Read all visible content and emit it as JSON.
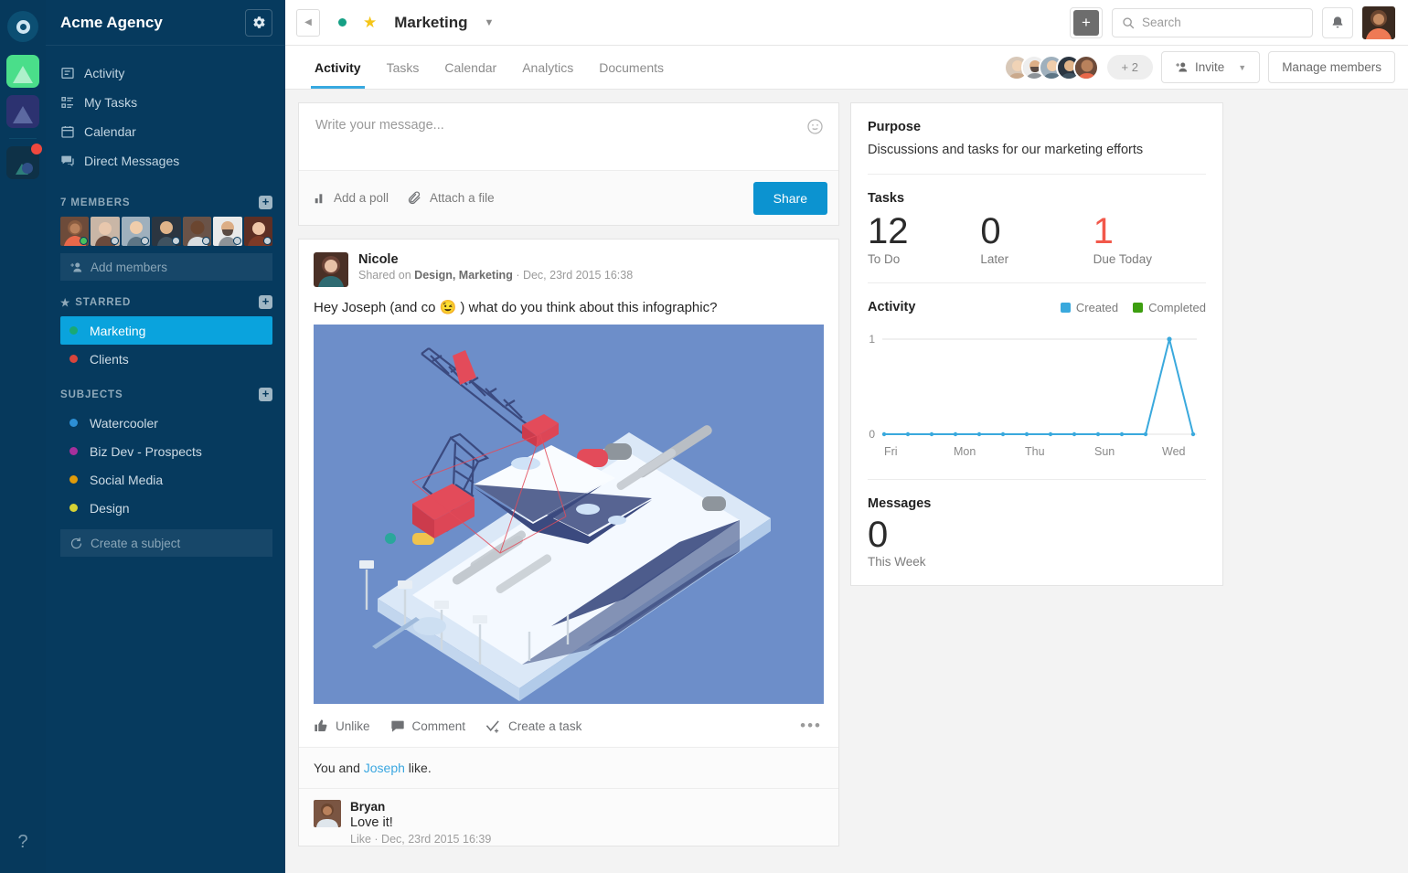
{
  "workspace": {
    "title": "Acme Agency",
    "gear_icon": "gear-icon",
    "rail_items": [
      "workspace-green",
      "workspace-navy",
      "workspace-dark"
    ],
    "help_label": "?"
  },
  "sidebar": {
    "nav": [
      {
        "label": "Activity",
        "icon": "activity-icon"
      },
      {
        "label": "My Tasks",
        "icon": "tasks-icon"
      },
      {
        "label": "Calendar",
        "icon": "calendar-icon"
      },
      {
        "label": "Direct Messages",
        "icon": "messages-icon"
      }
    ],
    "members_header": "7 MEMBERS",
    "members_count": 7,
    "member_status": [
      "online",
      "offline",
      "offline",
      "offline",
      "offline",
      "offline",
      "offline"
    ],
    "add_members_label": "Add members",
    "starred_header": "STARRED",
    "starred": [
      {
        "label": "Marketing",
        "color": "#19a974",
        "active": true
      },
      {
        "label": "Clients",
        "color": "#d9453c",
        "active": false
      }
    ],
    "subjects_header": "SUBJECTS",
    "subjects": [
      {
        "label": "Watercooler",
        "color": "#2d8fd5"
      },
      {
        "label": "Biz Dev - Prospects",
        "color": "#a6309c"
      },
      {
        "label": "Social Media",
        "color": "#e09b0a"
      },
      {
        "label": "Design",
        "color": "#d6d234"
      }
    ],
    "create_subject_label": "Create a subject"
  },
  "topbar": {
    "back_icon": "back-arrow-icon",
    "status_dot_color": "#16a085",
    "star_icon": "star-icon",
    "channel_name": "Marketing",
    "chevron_icon": "chevron-down-icon",
    "add_icon": "plus-icon",
    "search_placeholder": "Search",
    "search_value": "",
    "search_icon": "search-icon",
    "bell_icon": "bell-icon",
    "avatar": "user-avatar"
  },
  "tabs": [
    {
      "label": "Activity",
      "active": true
    },
    {
      "label": "Tasks",
      "active": false
    },
    {
      "label": "Calendar",
      "active": false
    },
    {
      "label": "Analytics",
      "active": false
    },
    {
      "label": "Documents",
      "active": false
    }
  ],
  "members_bar": {
    "overflow_label": "+ 2",
    "invite_label": "Invite",
    "invite_icon": "add-person-icon",
    "invite_chevron": "chevron-down-icon",
    "manage_label": "Manage members"
  },
  "composer": {
    "placeholder": "Write your message...",
    "value": "",
    "emoji_icon": "smiley-icon",
    "poll_label": "Add a poll",
    "poll_icon": "bar-chart-icon",
    "attach_label": "Attach a file",
    "attach_icon": "paperclip-icon",
    "share_label": "Share",
    "share_color": "#0c93d0"
  },
  "post": {
    "author": "Nicole",
    "meta_prefix": "Shared on ",
    "meta_channels": "Design, Marketing",
    "meta_suffix": " · Dec, 23rd 2015 16:38",
    "text": "Hey Joseph (and co 😉 ) what do you think about this infographic?",
    "image_alt": "isometric-crane-smartphone-illustration",
    "image_bg": "#6d8ec9",
    "actions": [
      {
        "label": "Unlike",
        "icon": "thumbs-up-icon"
      },
      {
        "label": "Comment",
        "icon": "comment-icon"
      },
      {
        "label": "Create a task",
        "icon": "check-task-icon"
      }
    ],
    "more_icon": "ellipsis-icon",
    "likes_prefix": "You  and  ",
    "likes_link": "Joseph",
    "likes_suffix": "  like.",
    "comment": {
      "author": "Bryan",
      "body": "Love it!",
      "meta": "Like · Dec, 23rd 2015 16:39"
    }
  },
  "right_panel": {
    "purpose_title": "Purpose",
    "purpose_text": "Discussions and tasks for our marketing efforts",
    "tasks_title": "Tasks",
    "tasks": [
      {
        "value": "12",
        "label": "To Do",
        "red": false
      },
      {
        "value": "0",
        "label": "Later",
        "red": false
      },
      {
        "value": "1",
        "label": "Due Today",
        "red": true
      }
    ],
    "activity_title": "Activity",
    "messages_title": "Messages",
    "messages_value": "0",
    "messages_label": "This Week"
  },
  "chart_data": {
    "type": "line",
    "title": "Activity",
    "xlabel": "",
    "ylabel": "",
    "ylim": [
      0,
      1
    ],
    "yticks": [
      0,
      1
    ],
    "grid": true,
    "legend_position": "top-right",
    "categories": [
      "Fri",
      "",
      "",
      "Mon",
      "",
      "",
      "Thu",
      "",
      "",
      "Sun",
      "",
      "",
      "Wed",
      ""
    ],
    "tick_labels_shown": [
      "Fri",
      "Mon",
      "Thu",
      "Sun",
      "Wed"
    ],
    "series": [
      {
        "name": "Created",
        "color": "#3aa9dd",
        "values": [
          0,
          0,
          0,
          0,
          0,
          0,
          0,
          0,
          0,
          0,
          0,
          0,
          1,
          0
        ]
      },
      {
        "name": "Completed",
        "color": "#3d9e10",
        "values": [
          0,
          0,
          0,
          0,
          0,
          0,
          0,
          0,
          0,
          0,
          0,
          0,
          0,
          0
        ]
      }
    ]
  }
}
